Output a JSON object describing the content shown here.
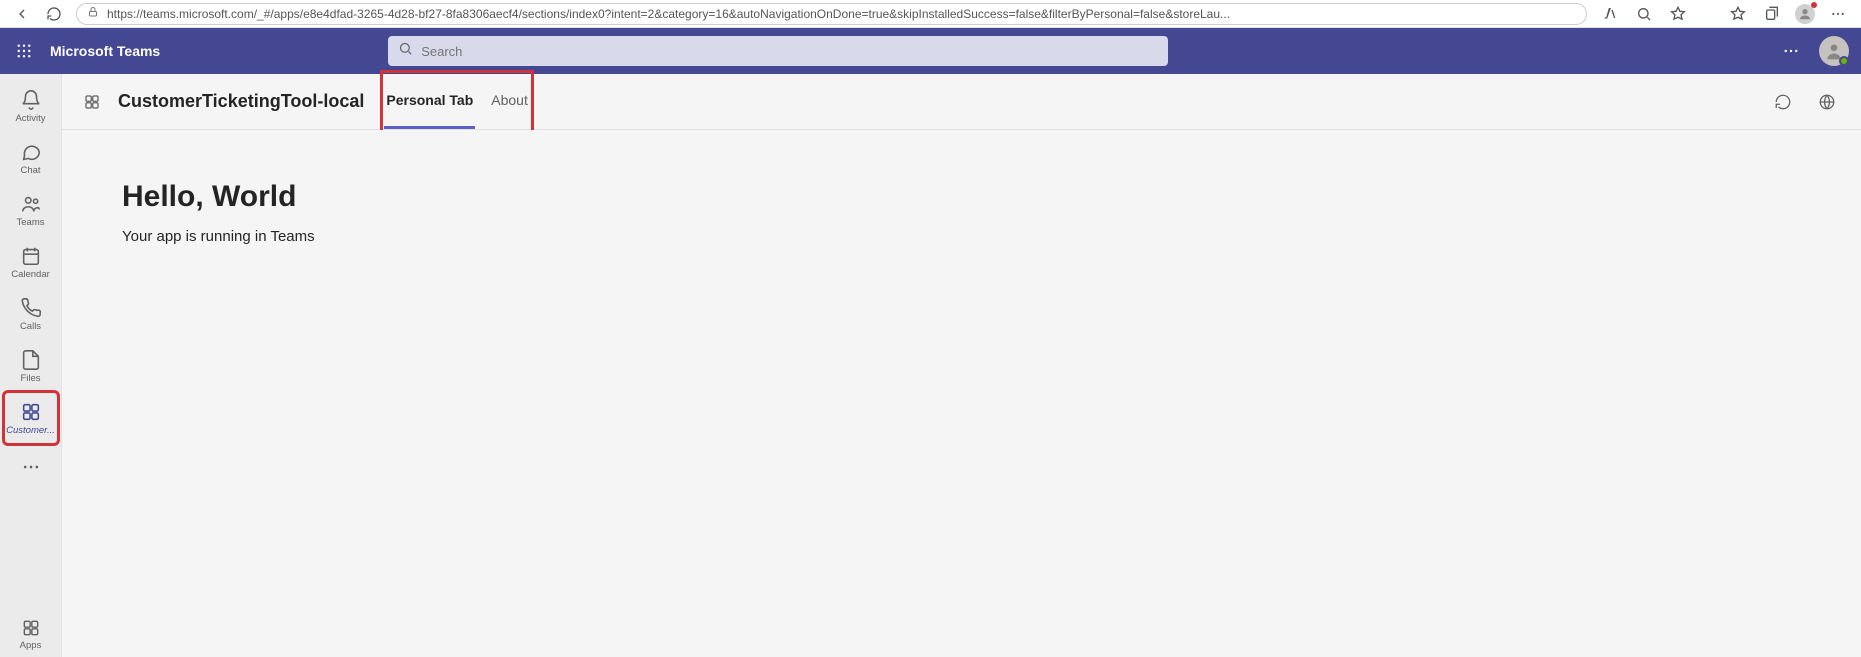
{
  "browser": {
    "url": "https://teams.microsoft.com/_#/apps/e8e4dfad-3265-4d28-bf27-8fa8306aecf4/sections/index0?intent=2&category=16&autoNavigationOnDone=true&skipInstalledSuccess=false&filterByPersonal=false&storeLau..."
  },
  "header": {
    "brand": "Microsoft Teams",
    "search_placeholder": "Search"
  },
  "rail": {
    "items": [
      {
        "label": "Activity",
        "icon": "bell-icon"
      },
      {
        "label": "Chat",
        "icon": "chat-icon"
      },
      {
        "label": "Teams",
        "icon": "people-icon"
      },
      {
        "label": "Calendar",
        "icon": "calendar-icon"
      },
      {
        "label": "Calls",
        "icon": "phone-icon"
      },
      {
        "label": "Files",
        "icon": "file-icon"
      },
      {
        "label": "Customer...",
        "icon": "apps-grid-icon"
      }
    ],
    "apps_label": "Apps"
  },
  "app": {
    "title": "CustomerTicketingTool-local",
    "tabs": [
      {
        "label": "Personal Tab"
      },
      {
        "label": "About"
      }
    ]
  },
  "content": {
    "heading": "Hello, World",
    "subtext": "Your app is running in Teams"
  }
}
